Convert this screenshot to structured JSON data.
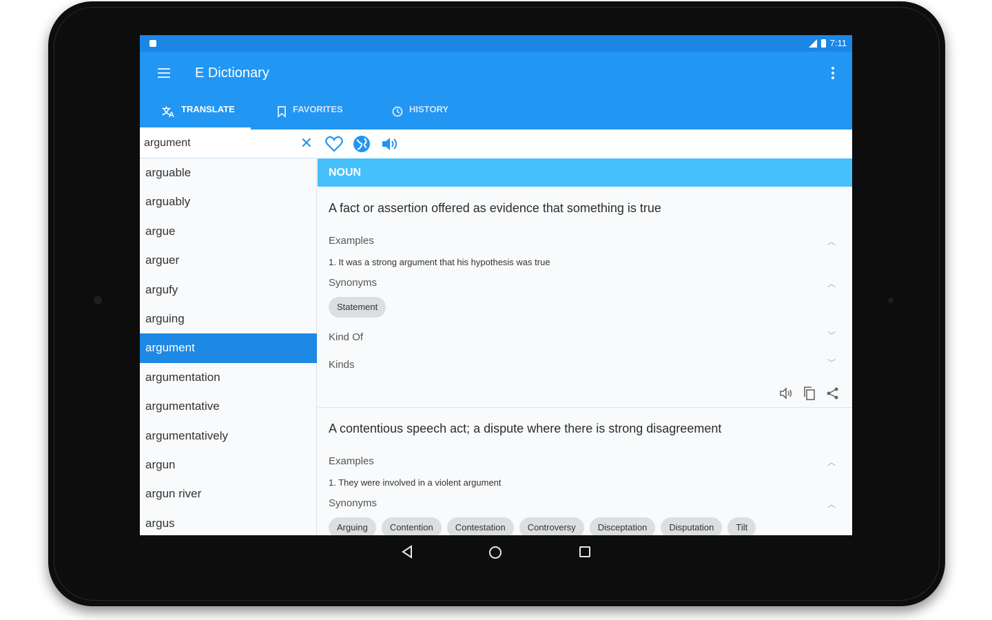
{
  "status_bar": {
    "time": "7:11"
  },
  "app": {
    "title": "E Dictionary",
    "accent_color": "#2196f3",
    "tabs": [
      {
        "label": "TRANSLATE",
        "icon": "translate-icon",
        "selected": true
      },
      {
        "label": "FAVORITES",
        "icon": "bookmark-icon",
        "selected": false
      },
      {
        "label": "HISTORY",
        "icon": "history-icon",
        "selected": false
      }
    ]
  },
  "search": {
    "value": "argument",
    "clear_icon": "close-icon"
  },
  "word_list": [
    "arguable",
    "arguably",
    "argue",
    "arguer",
    "argufy",
    "arguing",
    "argument",
    "argumentation",
    "argumentative",
    "argumentatively",
    "argun",
    "argun river",
    "argus"
  ],
  "selected_word": "argument",
  "actions": [
    "heart-icon",
    "globe-icon",
    "speaker-icon"
  ],
  "entry": {
    "part_of_speech": "NOUN",
    "senses": [
      {
        "definition": "A fact or assertion offered as evidence that something is true",
        "examples_label": "Examples",
        "examples": [
          "1. It was a strong argument that his hypothesis was true"
        ],
        "synonyms_label": "Synonyms",
        "synonyms": [
          "Statement"
        ],
        "kind_of_label": "Kind Of",
        "kinds_label": "Kinds"
      },
      {
        "definition": "A contentious speech act; a dispute where there is strong disagreement",
        "examples_label": "Examples",
        "examples": [
          "1. They were involved in a violent argument"
        ],
        "synonyms_label": "Synonyms",
        "synonyms": [
          "Arguing",
          "Contention",
          "Contestation",
          "Controversy",
          "Disceptation",
          "Disputation",
          "Tilt"
        ]
      }
    ]
  }
}
